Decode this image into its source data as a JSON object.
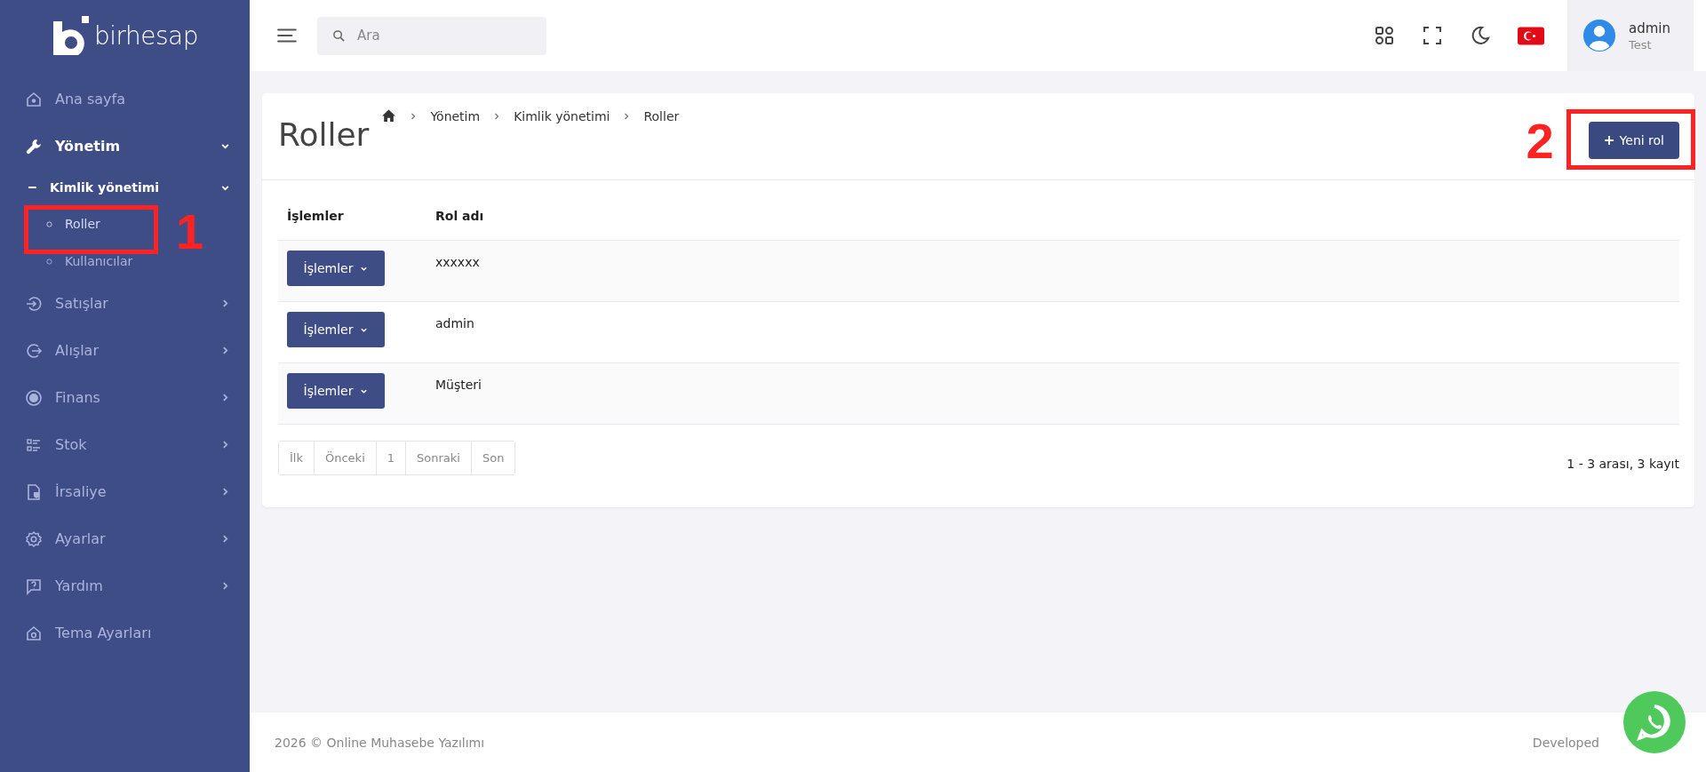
{
  "logo": {
    "text": "birhesap"
  },
  "sidebar": {
    "items": [
      {
        "label": "Ana sayfa",
        "kind": "link",
        "selected": false
      },
      {
        "label": "Yönetim",
        "kind": "menu",
        "selected": true,
        "expanded": true,
        "children": [
          {
            "label": "Kimlik yönetimi",
            "selected": true,
            "expanded": true,
            "children": [
              {
                "label": "Roller",
                "selected": true,
                "annotation": "1"
              },
              {
                "label": "Kullanıcılar",
                "selected": false
              }
            ]
          }
        ]
      },
      {
        "label": "Satışlar",
        "kind": "menu",
        "selected": false,
        "expanded": false
      },
      {
        "label": "Alışlar",
        "kind": "menu",
        "selected": false,
        "expanded": false
      },
      {
        "label": "Finans",
        "kind": "menu",
        "selected": false,
        "expanded": false
      },
      {
        "label": "Stok",
        "kind": "menu",
        "selected": false,
        "expanded": false
      },
      {
        "label": "İrsaliye",
        "kind": "menu",
        "selected": false,
        "expanded": false
      },
      {
        "label": "Ayarlar",
        "kind": "menu",
        "selected": false,
        "expanded": false
      },
      {
        "label": "Yardım",
        "kind": "menu",
        "selected": false,
        "expanded": false
      },
      {
        "label": "Tema Ayarları",
        "kind": "link",
        "selected": false
      }
    ]
  },
  "header": {
    "search": {
      "placeholder": "Ara"
    },
    "user": {
      "name": "admin",
      "role": "Test"
    }
  },
  "page": {
    "title": "Roller",
    "breadcrumb": [
      "Yönetim",
      "Kimlik yönetimi",
      "Roller"
    ],
    "new_button": {
      "label": "Yeni rol",
      "annotation": "2"
    }
  },
  "table": {
    "columns": [
      "İşlemler",
      "Rol adı"
    ],
    "rows": [
      {
        "action": "İşlemler",
        "name": "xxxxxx"
      },
      {
        "action": "İşlemler",
        "name": "admin"
      },
      {
        "action": "İşlemler",
        "name": "Müşteri"
      }
    ]
  },
  "pagination": {
    "pages": [
      "İlk",
      "Önceki",
      "1",
      "Sonraki",
      "Son"
    ],
    "summary": "1 - 3 arası, 3 kayıt"
  },
  "footer": {
    "copyright": "2026 © Online Muhasebe Yazılımı",
    "credit": "Developed"
  }
}
